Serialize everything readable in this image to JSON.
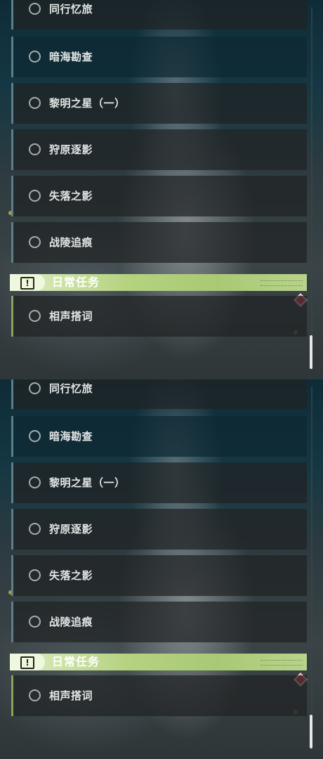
{
  "category": {
    "title": "日常任务"
  },
  "quests": [
    "同行忆旅",
    "暗海勘查",
    "黎明之星（一）",
    "狩原逐影",
    "失落之影",
    "战陵追痕"
  ],
  "daily_quests": [
    "相声搭词"
  ],
  "colors": {
    "accent_green": "#b5d27f",
    "quest_bar": "#5d7f89",
    "marker_red": "#d9434f"
  }
}
